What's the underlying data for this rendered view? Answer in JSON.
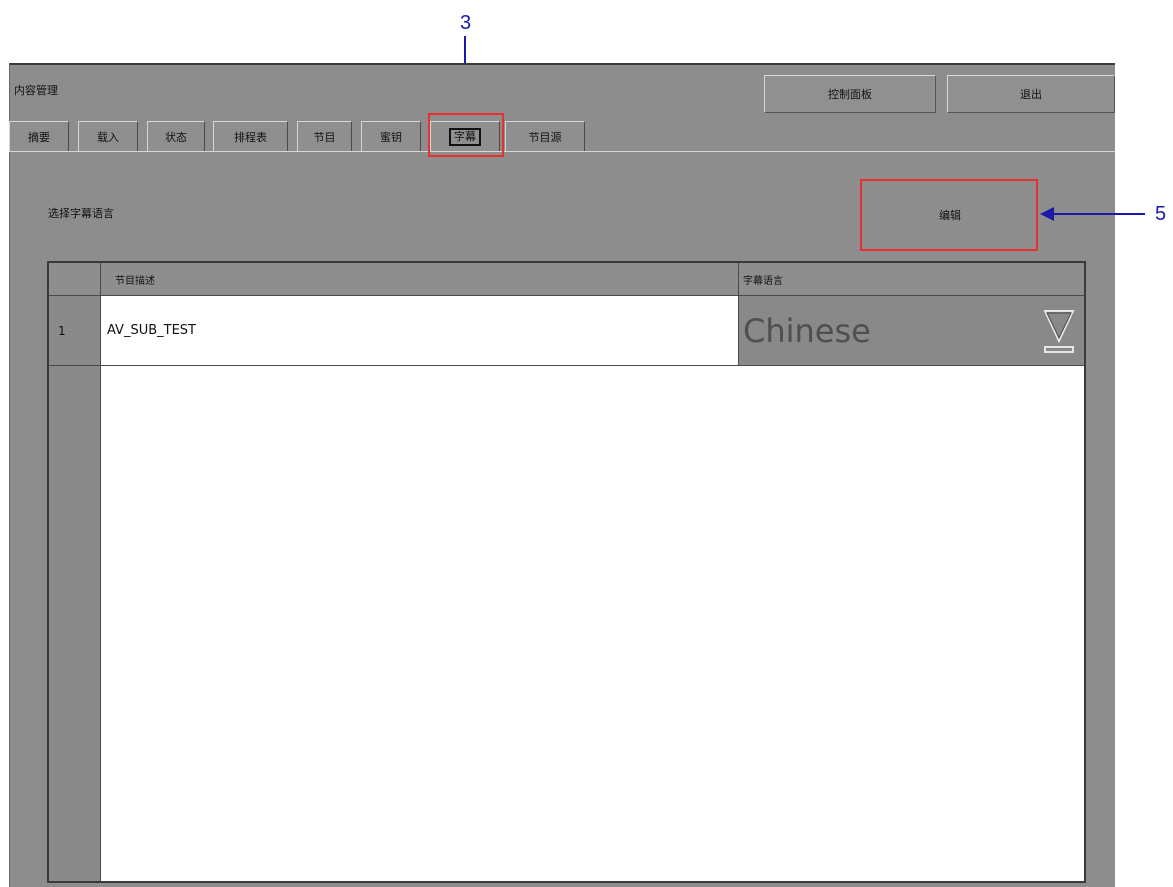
{
  "window": {
    "title": "内容管理"
  },
  "toolbar": {
    "control_panel_label": "控制面板",
    "exit_label": "退出"
  },
  "tabs": [
    {
      "label": "摘要"
    },
    {
      "label": "载入"
    },
    {
      "label": "状态"
    },
    {
      "label": "排程表"
    },
    {
      "label": "节目"
    },
    {
      "label": "蜜钥"
    },
    {
      "label": "字幕",
      "active": true
    },
    {
      "label": "节目源"
    }
  ],
  "panel": {
    "select_label": "选择字幕语言",
    "edit_label": "编辑"
  },
  "table": {
    "columns": [
      "节目描述",
      "字幕语言"
    ],
    "rows": [
      {
        "num": "1",
        "description": "AV_SUB_TEST",
        "language": "Chinese"
      }
    ]
  },
  "annotations": {
    "tab_marker": "3",
    "edit_marker": "5"
  },
  "colors": {
    "annotation_box": "#e8312f",
    "annotation_arrow": "#1a1aa6",
    "panel_bg": "#8d8d8d"
  },
  "icons": {
    "dropdown": "triangle-down-icon"
  }
}
